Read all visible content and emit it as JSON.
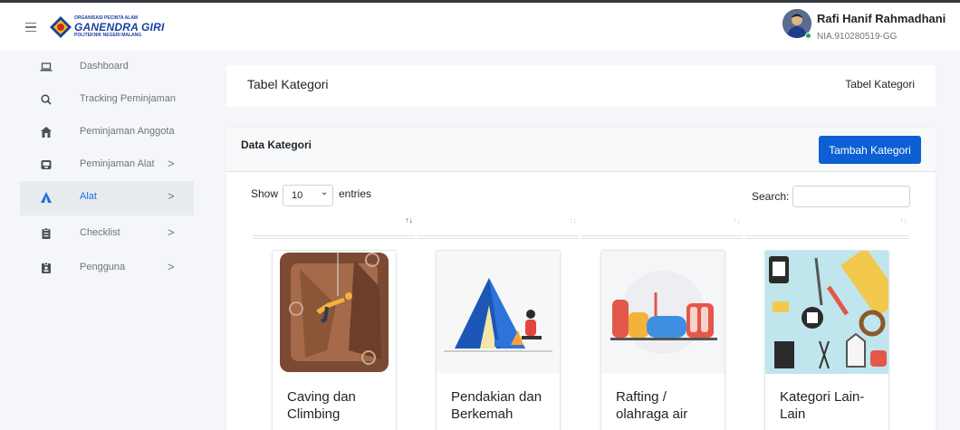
{
  "app": {
    "org_line1": "ORGANISASI PECINTA ALAM",
    "org_name": "GANENDRA GIRI",
    "org_line3": "POLITEKNIK NEGERI MALANG"
  },
  "user": {
    "name": "Rafi Hanif Rahmadhani",
    "id": "NIA.910280519-GG",
    "status_color": "#28a745"
  },
  "sidebar": {
    "items": [
      {
        "label": "Dashboard",
        "icon": "laptop-icon",
        "chevron": ""
      },
      {
        "label": "Tracking Peminjaman",
        "icon": "search-icon",
        "chevron": ""
      },
      {
        "label": "Peminjaman Anggota",
        "icon": "users-icon",
        "chevron": ""
      },
      {
        "label": "Peminjaman Alat",
        "icon": "inbox-icon",
        "chevron": ">"
      },
      {
        "label": "Alat",
        "icon": "tent-icon",
        "chevron": ">",
        "active": true
      },
      {
        "label": "Checklist",
        "icon": "clipboard-icon",
        "chevron": ">"
      },
      {
        "label": "Pengguna",
        "icon": "id-card-icon",
        "chevron": ">"
      }
    ]
  },
  "header": {
    "title": "Tabel Kategori",
    "breadcrumb": "Tabel Kategori"
  },
  "card": {
    "title": "Data Kategori",
    "add_button": "Tambah Kategori",
    "accent": "#0d5fd3"
  },
  "table": {
    "show_label": "Show",
    "entries_value": "10",
    "entries_label": "entries",
    "search_label": "Search:",
    "search_value": ""
  },
  "categories": [
    {
      "title": "Caving dan Climbing",
      "icon": "caving-illustration"
    },
    {
      "title": "Pendakian dan Berkemah",
      "icon": "camping-illustration"
    },
    {
      "title": "Rafting / olahraga air",
      "icon": "rafting-illustration"
    },
    {
      "title": "Kategori Lain-Lain",
      "icon": "tools-illustration"
    }
  ]
}
